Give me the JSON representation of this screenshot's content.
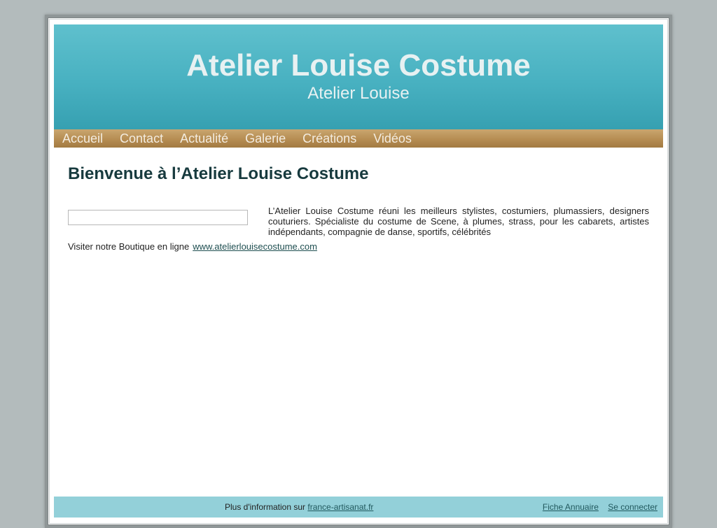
{
  "header": {
    "site_title": "Atelier Louise Costume",
    "site_subtitle": "Atelier Louise"
  },
  "nav": {
    "items": [
      {
        "label": "Accueil"
      },
      {
        "label": "Contact"
      },
      {
        "label": "Actualité"
      },
      {
        "label": "Galerie"
      },
      {
        "label": "Créations"
      },
      {
        "label": "Vidéos"
      }
    ]
  },
  "main": {
    "heading": "Bienvenue à l’Atelier Louise Costume",
    "intro": "L’Atelier Louise Costume réuni les meilleurs stylistes, costumiers, plumassiers, designers couturiers. Spécialiste du costume de Scene, à plumes, strass, pour les cabarets, artistes indépendants, compagnie de danse, sportifs, célébrités",
    "visit_label": "Visiter notre Boutique en ligne",
    "visit_link": "www.atelierlouisecostume.com "
  },
  "footer": {
    "info_label": "Plus d'information sur",
    "info_link": "france-artisanat.fr",
    "directory_link": "Fiche Annuaire",
    "login_link": "Se connecter"
  },
  "colors": {
    "header_accent": "#48b1c1",
    "nav_bar": "#b68d52",
    "footer_bg": "#93d0d9",
    "heading_text": "#173a3e"
  }
}
